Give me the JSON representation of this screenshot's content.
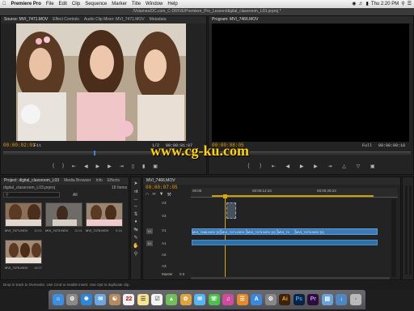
{
  "menubar": {
    "apple": "",
    "app_name": "Premiere Pro",
    "items": [
      "File",
      "Edit",
      "Clip",
      "Sequence",
      "Marker",
      "Title",
      "Window",
      "Help"
    ],
    "clock": "Thu 2:20 PM"
  },
  "titlebar": {
    "path": "/Volumes/DC.com_C-DRIVE/Premiere_Pro_Lesson/digital_classroom_L03.prproj *"
  },
  "source_panel": {
    "tabs": [
      "Source: MVI_7471.MOV",
      "Effect Controls",
      "Audio Clip Mixer: MVI_7471.MOV",
      "Metadata"
    ],
    "timecode_left": "00:00:02:01",
    "fit": "Fit",
    "fraction": "1/2",
    "timecode_right": "00:00:01:07"
  },
  "program_panel": {
    "tab": "Program: MVI_7466.MOV",
    "timecode_left": "00:00:08:05",
    "fit": "Full",
    "timecode_right": "00:00:09:18"
  },
  "watermark": "www.cg-ku.com",
  "project_panel": {
    "tabs": [
      "Project: digital_classroom_L03",
      "Media Browser",
      "Info",
      "Effects"
    ],
    "project_file": "digital_classroom_L03.prproj",
    "item_count": "18 Items",
    "bin_select": "All",
    "clips": [
      {
        "name": "MVI_7471.MOV",
        "dur": "10:01"
      },
      {
        "name": "MVI_7473.MOV",
        "dur": "11:01"
      },
      {
        "name": "MVI_7478.MOV",
        "dur": "5:18"
      },
      {
        "name": "MVI_7475.MOV",
        "dur": "18:07"
      }
    ]
  },
  "timeline_panel": {
    "tab": "MVI_7466.MOV",
    "timecode": "00:00:07:05",
    "ruler": [
      "00:00",
      "00:00:14:23",
      "00:00:29:23"
    ],
    "video_tracks": [
      "V3",
      "V2",
      "V1"
    ],
    "audio_tracks": [
      "A1",
      "A2",
      "A3"
    ],
    "master": "Master",
    "master_value": "0.0",
    "clips_v1": [
      "MVI_7466.MOV [V]",
      "MVI_7471.MOV [V]",
      "MVI_7473.MOV [V]",
      "MVI_74",
      "MVI_7473.MOV [V]"
    ]
  },
  "status_bar": "Drop in track to Overwrite. Use Cmd to enable insert. Use Opt to duplicate clip.",
  "dock": {
    "apps": [
      "Finder",
      "Launchpad",
      "Safari",
      "Mail",
      "Contacts",
      "Calendar",
      "Notes",
      "Reminders",
      "Maps",
      "Photos",
      "Messages",
      "FaceTime",
      "iTunes",
      "iBooks",
      "App Store",
      "Preferences",
      "Illustrator",
      "Photoshop",
      "Premiere Pro",
      "Folder",
      "Downloads",
      "Trash"
    ]
  }
}
